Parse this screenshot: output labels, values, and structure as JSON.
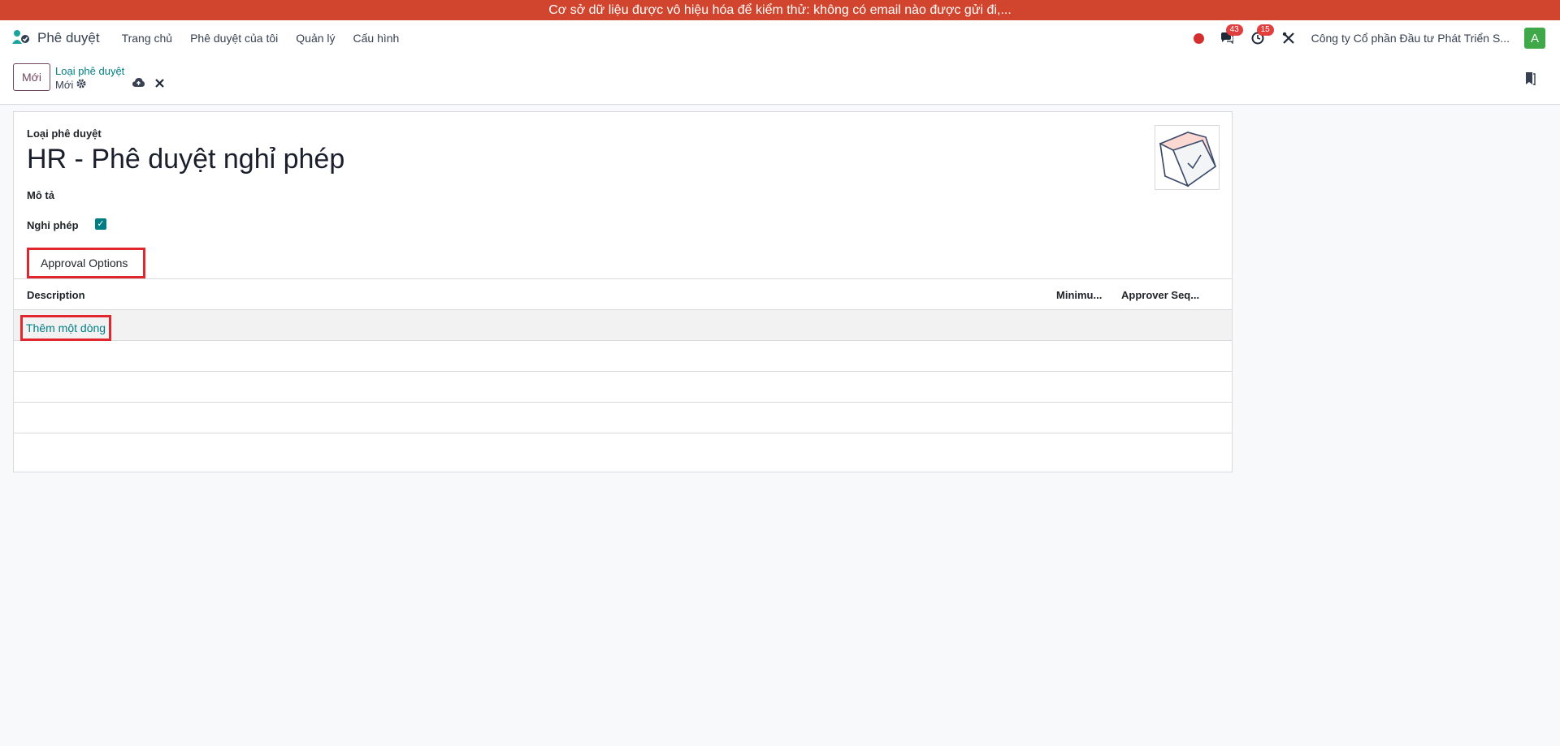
{
  "banner": {
    "text": "Cơ sở dữ liệu được vô hiệu hóa để kiểm thử: không có email nào được gửi đi,..."
  },
  "navbar": {
    "app_name": "Phê duyệt",
    "menu": [
      {
        "label": "Trang chủ"
      },
      {
        "label": "Phê duyệt của tôi"
      },
      {
        "label": "Quản lý"
      },
      {
        "label": "Cấu hình"
      }
    ],
    "messages_count": "43",
    "activities_count": "15",
    "company": "Công ty Cổ phần Đầu tư Phát Triển S...",
    "avatar_letter": "A"
  },
  "control_panel": {
    "new_button": "Mới",
    "breadcrumb_parent": "Loại phê duyệt",
    "breadcrumb_current": "Mới"
  },
  "form": {
    "type_label": "Loại phê duyệt",
    "title": "HR - Phê duyệt nghỉ phép",
    "description_label": "Mô tả",
    "leave_label": "Nghỉ phép",
    "leave_checked": true,
    "tab_label": "Approval Options",
    "table": {
      "headers": [
        "Description",
        "Minimu...",
        "Approver Seq..."
      ],
      "add_line": "Thêm một dòng"
    }
  },
  "colors": {
    "brand": "#71465f",
    "accent": "#017e84",
    "banner": "#d1452e",
    "highlight": "#e2262e"
  }
}
